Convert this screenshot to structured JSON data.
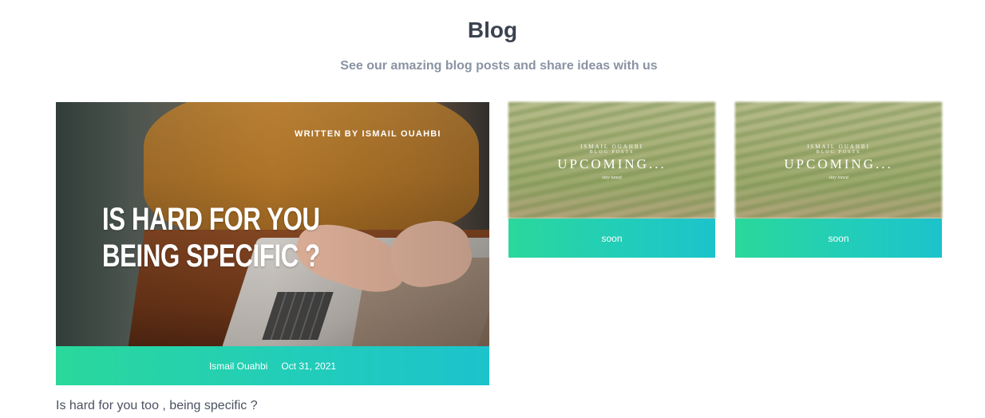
{
  "header": {
    "title": "Blog",
    "subtitle": "See our amazing blog posts and share ideas with us"
  },
  "featured_post": {
    "image_byline": "WRITTEN BY ISMAIL OUAHBI",
    "image_headline_line1": "IS HARD FOR YOU",
    "image_headline_line2": "BEING SPECIFIC ?",
    "author": "Ismail Ouahbi",
    "date": "Oct 31, 2021",
    "caption": "Is hard for you too , being specific ?"
  },
  "upcoming_posts": [
    {
      "image_author": "ISMAIL OUAHBI",
      "image_subtitle": "BLOG POSTS",
      "image_title": "UPCOMING...",
      "image_tagline": "stay tuned",
      "status": "soon"
    },
    {
      "image_author": "ISMAIL OUAHBI",
      "image_subtitle": "BLOG POSTS",
      "image_title": "UPCOMING...",
      "image_tagline": "stay tuned",
      "status": "soon"
    }
  ],
  "colors": {
    "accent_start": "#2ad89b",
    "accent_end": "#1cc3cc",
    "title_text": "#3b4250",
    "subtitle_text": "#8a93a3"
  }
}
